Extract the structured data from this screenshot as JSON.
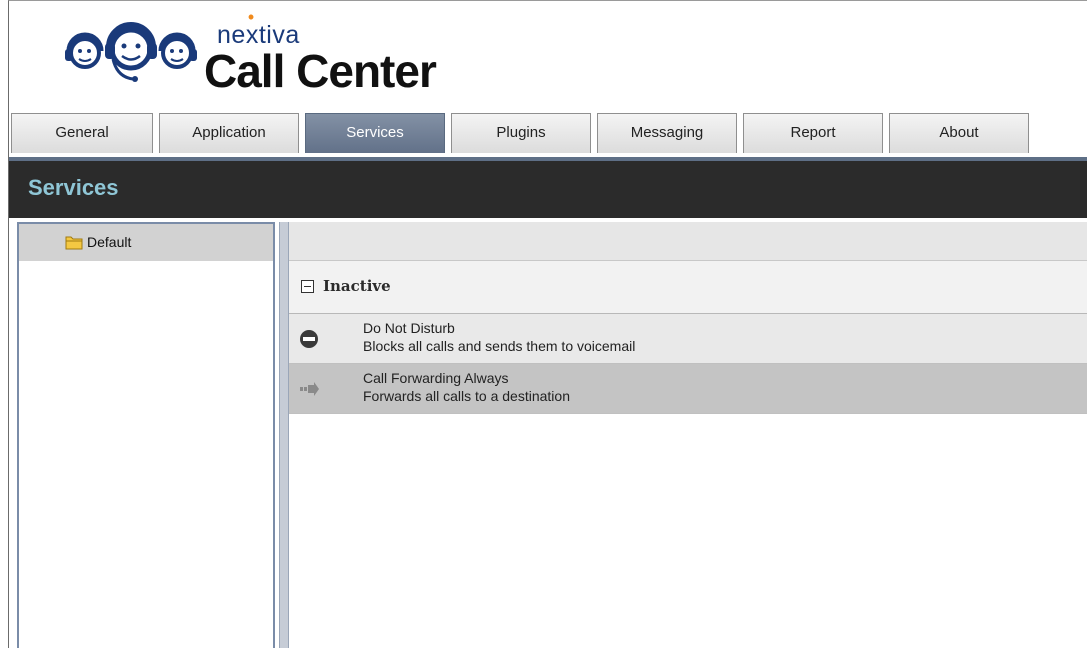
{
  "brand": {
    "name": "nextiva",
    "product": "Call Center"
  },
  "tabs": [
    {
      "label": "General",
      "active": false
    },
    {
      "label": "Application",
      "active": false
    },
    {
      "label": "Services",
      "active": true
    },
    {
      "label": "Plugins",
      "active": false
    },
    {
      "label": "Messaging",
      "active": false
    },
    {
      "label": "Report",
      "active": false
    },
    {
      "label": "About",
      "active": false
    }
  ],
  "page_title": "Services",
  "sidebar": {
    "items": [
      {
        "label": "Default",
        "icon": "folder-icon",
        "selected": true
      }
    ]
  },
  "group": {
    "label": "Inactive",
    "icon": "collapse-icon",
    "expanded": true
  },
  "services": [
    {
      "name": "Do Not Disturb",
      "description": "Blocks all calls and sends them to voicemail",
      "icon": "do-not-disturb-icon"
    },
    {
      "name": "Call Forwarding Always",
      "description": "Forwards all calls to a destination",
      "icon": "forward-arrow-icon"
    }
  ],
  "colors": {
    "tab_active": "#6b7a91",
    "title_bar": "#2b2b2b",
    "title_text": "#8fc6d6",
    "brand_blue": "#1a3a7a",
    "brand_orange": "#f08a1c"
  }
}
